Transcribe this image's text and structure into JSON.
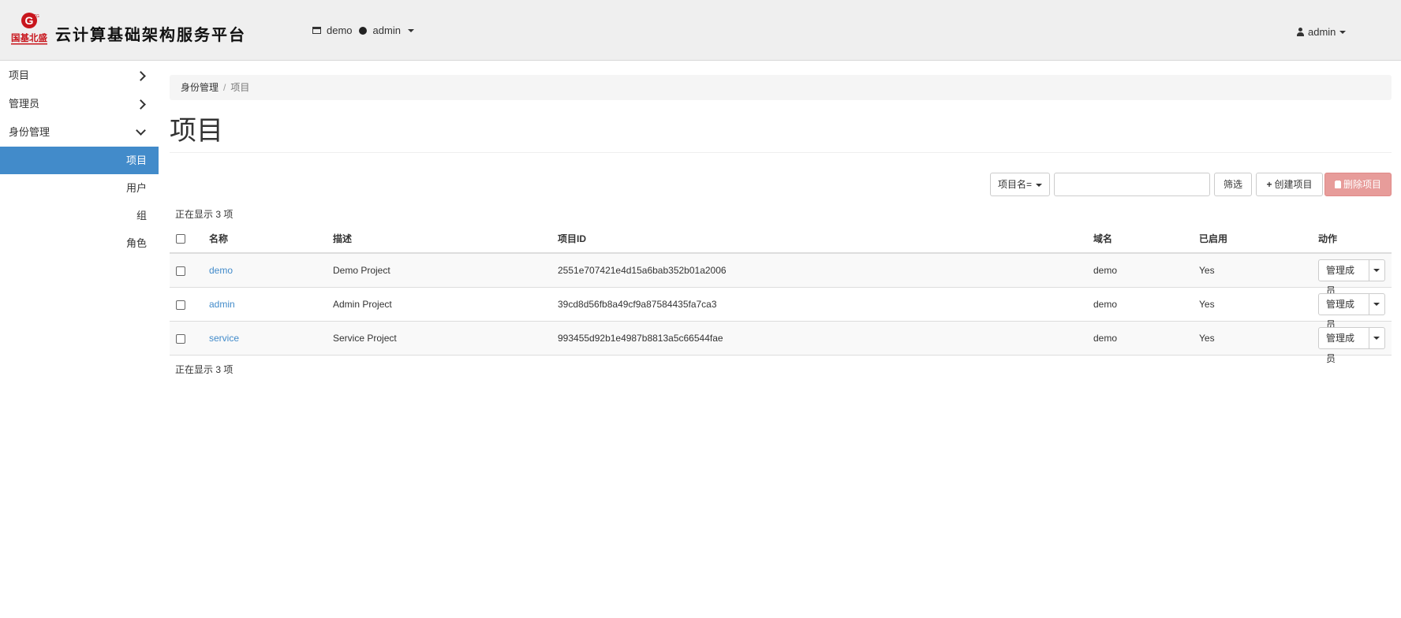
{
  "header": {
    "logo_text": "国基北盛",
    "title": "云计算基础架构服务平台",
    "project_context": {
      "project": "demo",
      "user": "admin"
    },
    "user_menu": "admin"
  },
  "sidebar": {
    "items": [
      {
        "label": "项目",
        "state": "collapsed"
      },
      {
        "label": "管理员",
        "state": "collapsed"
      },
      {
        "label": "身份管理",
        "state": "expanded"
      }
    ],
    "identity_subitems": [
      {
        "label": "项目",
        "active": true
      },
      {
        "label": "用户",
        "active": false
      },
      {
        "label": "组",
        "active": false
      },
      {
        "label": "角色",
        "active": false
      }
    ]
  },
  "breadcrumb": {
    "parent": "身份管理",
    "separator": "/",
    "current": "项目"
  },
  "page": {
    "title": "项目"
  },
  "toolbar": {
    "filter_select": "项目名=",
    "filter_value": "",
    "filter_button": "筛选",
    "create_button": "创建项目",
    "delete_button": "删除项目"
  },
  "table": {
    "count_top": "正在显示 3 项",
    "count_bottom": "正在显示 3 项",
    "headers": [
      "名称",
      "描述",
      "项目ID",
      "域名",
      "已启用",
      "动作"
    ],
    "rows": [
      {
        "name": "demo",
        "description": "Demo Project",
        "id": "2551e707421e4d15a6bab352b01a2006",
        "domain": "demo",
        "enabled": "Yes",
        "action": "管理成员"
      },
      {
        "name": "admin",
        "description": "Admin Project",
        "id": "39cd8d56fb8a49cf9a87584435fa7ca3",
        "domain": "demo",
        "enabled": "Yes",
        "action": "管理成员"
      },
      {
        "name": "service",
        "description": "Service Project",
        "id": "993455d92b1e4987b8813a5c66544fae",
        "domain": "demo",
        "enabled": "Yes",
        "action": "管理成员"
      }
    ]
  },
  "colors": {
    "accent": "#428bca",
    "danger_disabled": "#e79c9a",
    "topbar": "#efefef",
    "logo_red": "#c8161d"
  }
}
